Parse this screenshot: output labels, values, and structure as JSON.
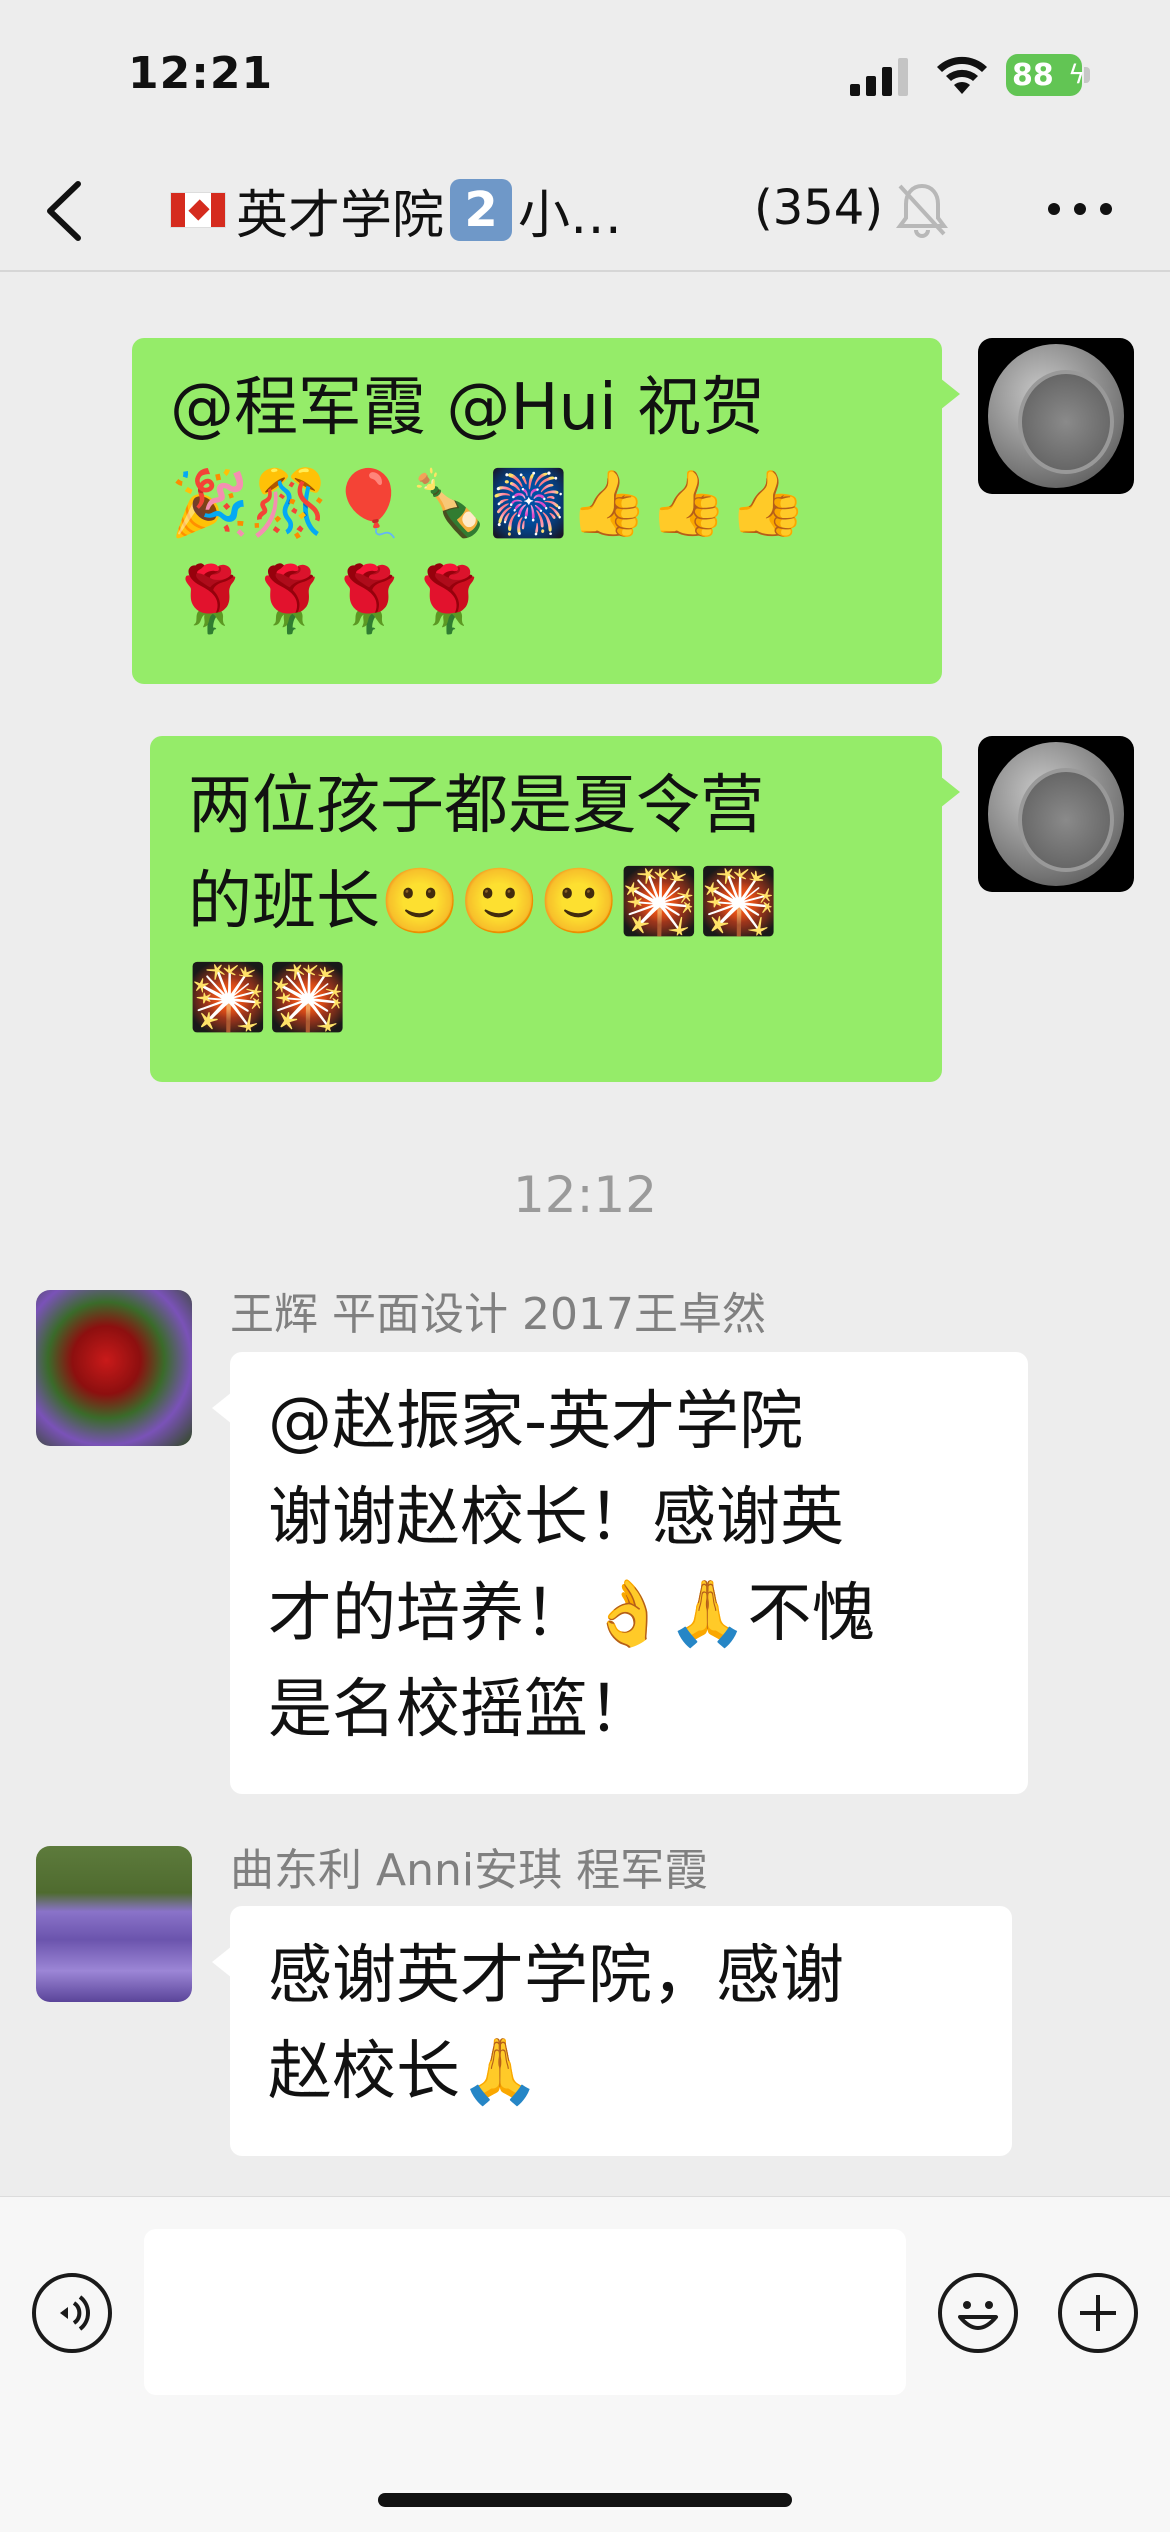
{
  "status_bar": {
    "time": "12:21",
    "battery": "88"
  },
  "nav": {
    "title_prefix": "英才学院",
    "title_key": "2",
    "title_suffix": "小…",
    "member_count": "(354)"
  },
  "messages": [
    {
      "direction": "out",
      "text_line1": "@程军霞 @Hui 祝贺",
      "emoji_line2": "🎉🎊🎈🍾🎆👍👍👍",
      "emoji_line3": "🌹🌹🌹🌹"
    },
    {
      "direction": "out",
      "text_line1": "两位孩子都是夏令营",
      "text_line2": "的班长🙂🙂🙂🎇🎇",
      "emoji_line3": "🎇🎇"
    },
    {
      "direction": "in",
      "sender": "王辉 平面设计 2017王卓然",
      "line1": "@赵振家-英才学院",
      "line2": "谢谢赵校长！感谢英",
      "line3": "才的培养！👌🙏不愧",
      "line4": "是名校摇篮！"
    },
    {
      "direction": "in",
      "sender": "曲东利 Anni安琪 程军霞",
      "line1": "感谢英才学院，感谢",
      "line2": "赵校长🙏"
    }
  ],
  "timestamp": "12:12",
  "icons": {
    "back": "chevron-left-icon",
    "mute": "bell-slash-icon",
    "more": "ellipsis-icon",
    "voice": "voice-icon",
    "emoji": "smiley-icon",
    "plus": "plus-icon"
  }
}
